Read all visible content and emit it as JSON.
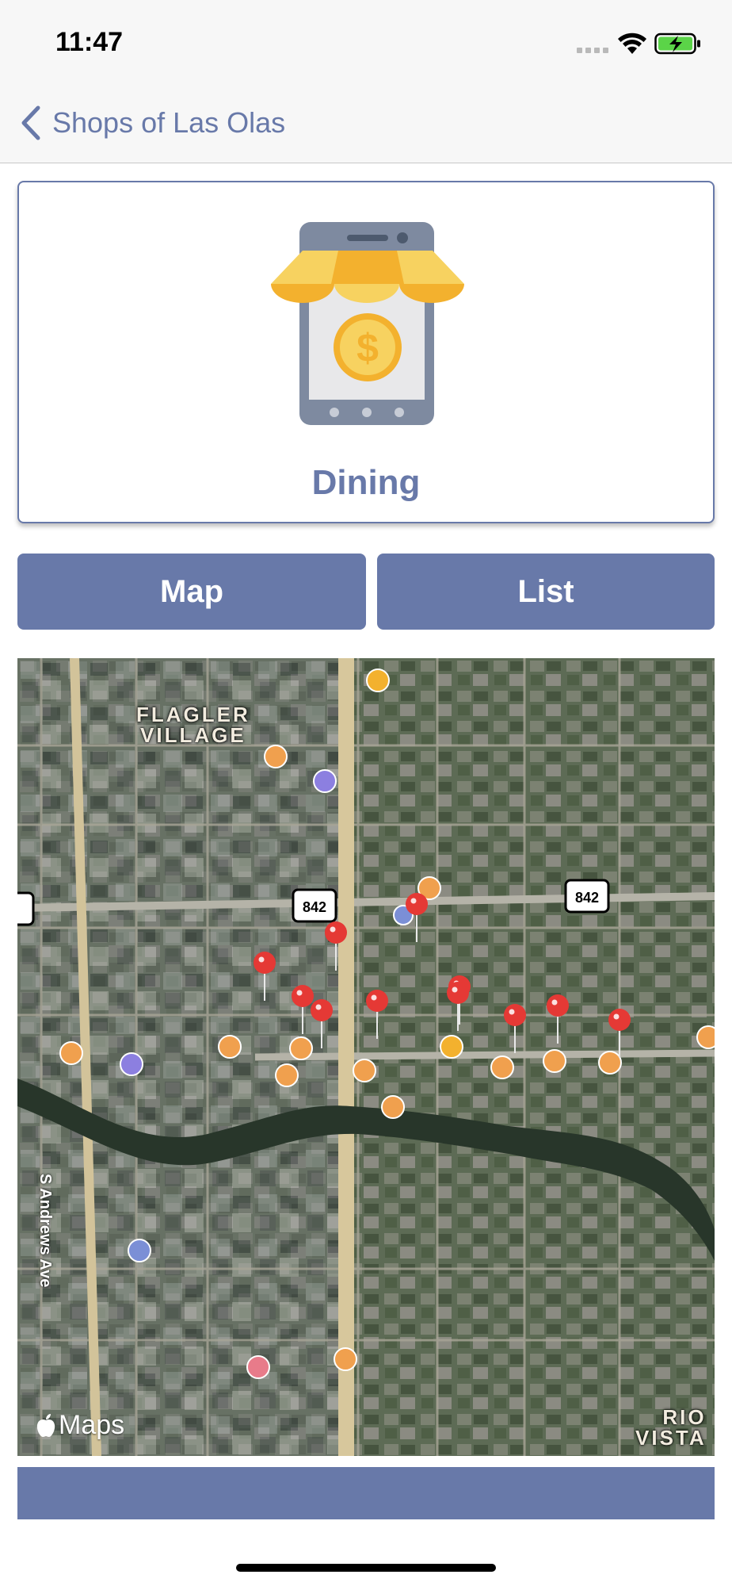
{
  "status_bar": {
    "time": "11:47",
    "wifi_icon": "wifi-icon",
    "battery_icon": "battery-charging-icon"
  },
  "nav": {
    "back_label": "Shops of Las Olas",
    "back_icon": "chevron-left-icon"
  },
  "category": {
    "title": "Dining",
    "icon": "mobile-shop-icon"
  },
  "buttons": {
    "map_label": "Map",
    "list_label": "List"
  },
  "map": {
    "attribution": "Maps",
    "labels": {
      "neighborhood_north": [
        "FLAGLER",
        "VILLAGE"
      ],
      "neighborhood_south": [
        "RIO",
        "VISTA"
      ],
      "street": "S Andrews Ave",
      "route_shield": "842"
    },
    "pins": {
      "count": 11,
      "color": "#e53935"
    },
    "poi_colors": {
      "food": "#f0a04e",
      "hotel": "#8c7fe0",
      "finance": "#7b8fd6",
      "medical": "#e87b8a",
      "shopping": "#f3b12e"
    }
  },
  "colors": {
    "accent": "#6879a9",
    "nav_background": "#f7f7f7",
    "battery": "#5bd448"
  }
}
